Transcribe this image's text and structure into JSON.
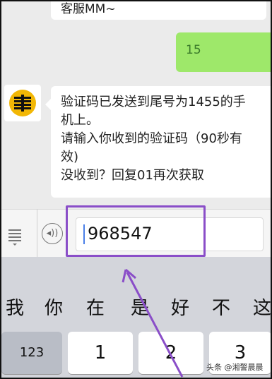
{
  "chat": {
    "previous_message": "客服MM~",
    "sent_message": "15",
    "bot_message_lines": [
      "验证码已发送到尾号为1455的手",
      "机上。",
      "请输入你收到的验证码（90秒有",
      "效)",
      "没收到？回复01再次获取"
    ]
  },
  "input": {
    "value": "968547",
    "voice_glyph": "◂))"
  },
  "keyboard": {
    "candidates": [
      "我",
      "你",
      "在",
      "是",
      "好",
      "不",
      "这"
    ],
    "keys": [
      "123",
      "1",
      "2",
      "3"
    ]
  },
  "watermark": "头条 @湘警晨晨",
  "colors": {
    "annotation": "#8a4ec8",
    "sent_bubble": "#9ee86a"
  }
}
